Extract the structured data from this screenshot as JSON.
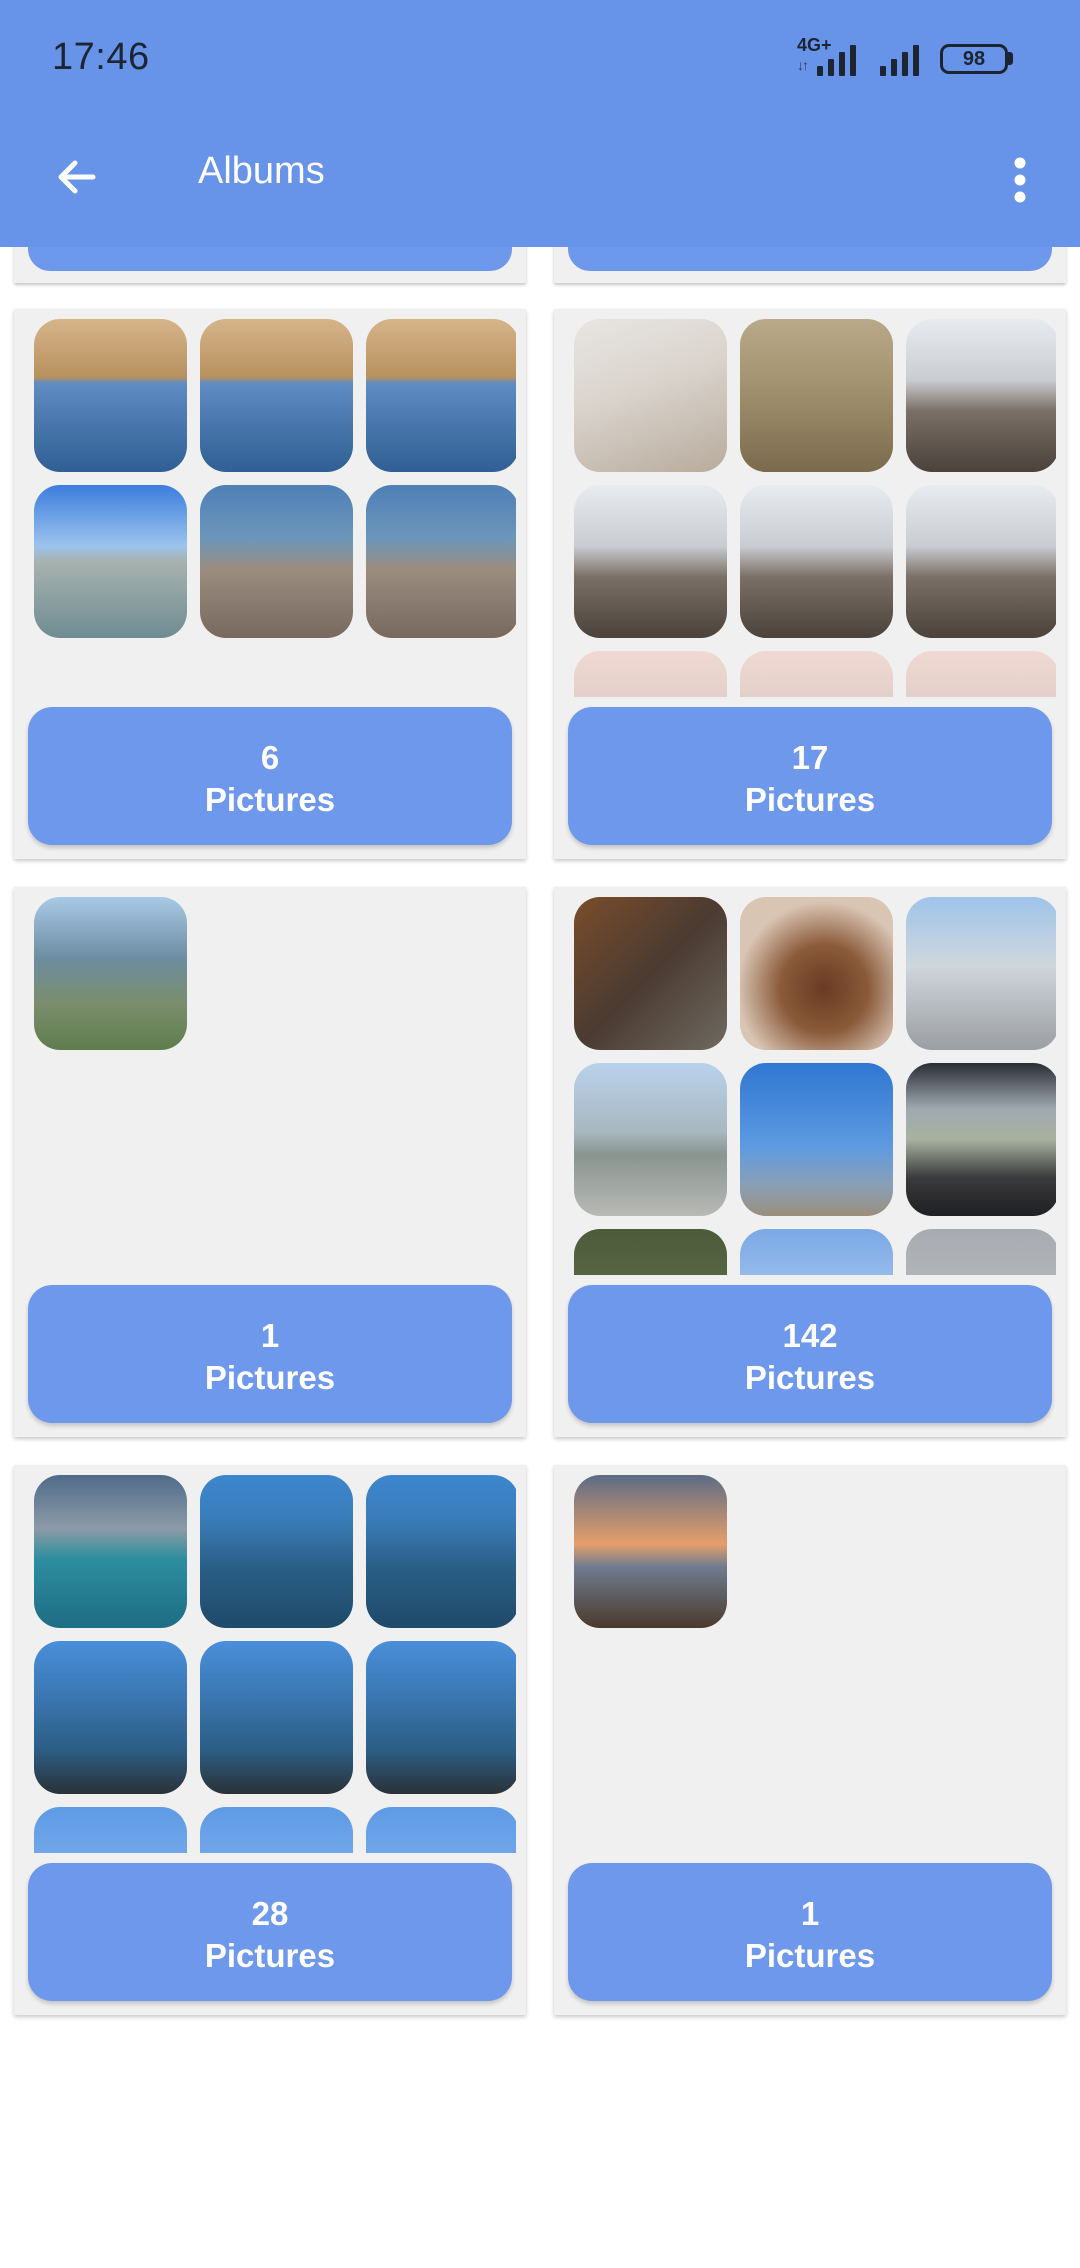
{
  "status_bar": {
    "time": "17:46",
    "network": "4G+",
    "battery": "98"
  },
  "app_bar": {
    "title": "Albums"
  },
  "albums": [
    {
      "count": "6",
      "label": "Pictures",
      "thumbs": [
        "img-sea-cliff",
        "img-sea-cliff",
        "img-sea-cliff",
        "img-beach-man",
        "img-rocks-mask",
        "img-rocks-mask"
      ]
    },
    {
      "count": "17",
      "label": "Pictures",
      "thumbs": [
        "img-shore-group",
        "img-sunset-water",
        "img-cliff-legs",
        "img-cliff-legs",
        "img-cliff-legs",
        "img-cliff-legs",
        "img-pink-sky",
        "img-pink-sky",
        "img-pink-sky"
      ]
    },
    {
      "count": "1",
      "label": "Pictures",
      "thumbs": [
        "img-cliff-sea"
      ]
    },
    {
      "count": "142",
      "label": "Pictures",
      "thumbs": [
        "img-cafe",
        "img-tagine",
        "img-gas",
        "img-road-trees",
        "img-blue-sky",
        "img-car",
        "img-trees",
        "img-light-sky",
        "img-grey-sky"
      ]
    },
    {
      "count": "28",
      "label": "Pictures",
      "thumbs": [
        "img-turquoise",
        "img-open-sea",
        "img-open-sea",
        "img-sea-motor",
        "img-sea-motor",
        "img-sea-motor",
        "img-sky-top",
        "img-sky-top",
        "img-sky-top"
      ]
    },
    {
      "count": "1",
      "label": "Pictures",
      "thumbs": [
        "img-sunset-beach"
      ]
    }
  ],
  "colors": {
    "app_bar": "#6794e8",
    "count_button": "#6e98ec",
    "card_background": "#f0f0f0"
  }
}
